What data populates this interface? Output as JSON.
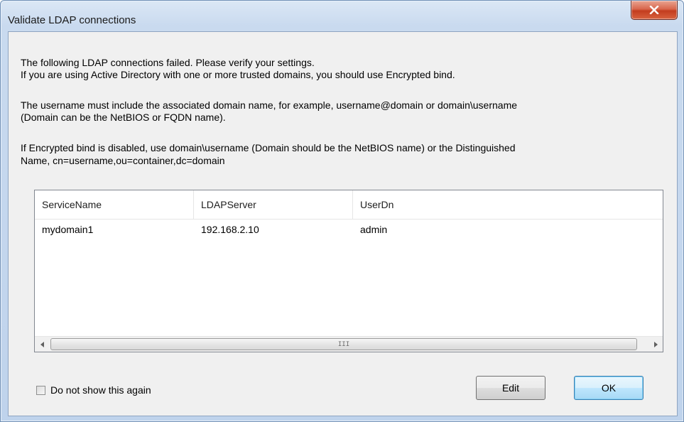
{
  "window": {
    "title": "Validate LDAP connections"
  },
  "message": {
    "line1": "The following LDAP connections failed. Please verify your settings.",
    "line2": "If you are using Active Directory with one or more trusted domains, you should use Encrypted bind.",
    "line3": "The username must include the associated domain name, for example, username@domain or domain\\username",
    "line4": "(Domain can be the NetBIOS or FQDN name).",
    "line5": "If Encrypted bind is disabled, use domain\\username (Domain should be the NetBIOS name) or the Distinguished",
    "line6": "Name, cn=username,ou=container,dc=domain"
  },
  "table": {
    "columns": [
      "ServiceName",
      "LDAPServer",
      "UserDn"
    ],
    "rows": [
      [
        "mydomain1",
        "192.168.2.10",
        "admin"
      ]
    ]
  },
  "scrollbar": {
    "grip": "III"
  },
  "footer": {
    "checkbox_label": "Do not show this again",
    "checkbox_checked": false,
    "edit_label": "Edit",
    "ok_label": "OK"
  },
  "icons": {
    "close": "close-icon",
    "scroll_left": "arrow-left-icon",
    "scroll_right": "arrow-right-icon"
  },
  "colors": {
    "close_button": "#c7432a",
    "default_button_border": "#3c7fb1"
  }
}
